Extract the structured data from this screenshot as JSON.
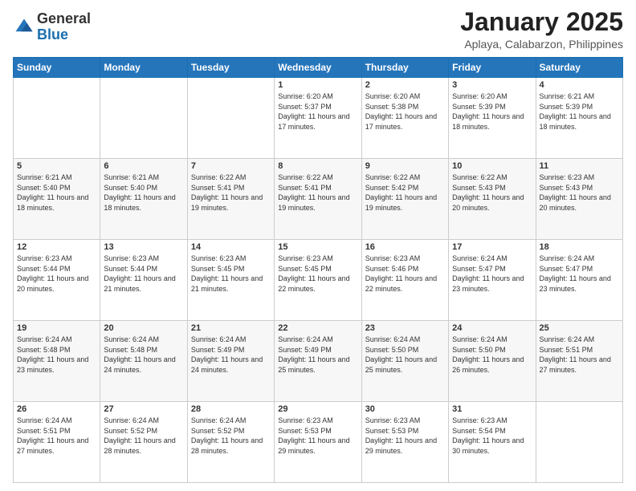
{
  "header": {
    "logo_general": "General",
    "logo_blue": "Blue",
    "month_title": "January 2025",
    "location": "Aplaya, Calabarzon, Philippines"
  },
  "weekdays": [
    "Sunday",
    "Monday",
    "Tuesday",
    "Wednesday",
    "Thursday",
    "Friday",
    "Saturday"
  ],
  "weeks": [
    [
      {
        "day": "",
        "sunrise": "",
        "sunset": "",
        "daylight": ""
      },
      {
        "day": "",
        "sunrise": "",
        "sunset": "",
        "daylight": ""
      },
      {
        "day": "",
        "sunrise": "",
        "sunset": "",
        "daylight": ""
      },
      {
        "day": "1",
        "sunrise": "6:20 AM",
        "sunset": "5:37 PM",
        "daylight": "11 hours and 17 minutes."
      },
      {
        "day": "2",
        "sunrise": "6:20 AM",
        "sunset": "5:38 PM",
        "daylight": "11 hours and 17 minutes."
      },
      {
        "day": "3",
        "sunrise": "6:20 AM",
        "sunset": "5:39 PM",
        "daylight": "11 hours and 18 minutes."
      },
      {
        "day": "4",
        "sunrise": "6:21 AM",
        "sunset": "5:39 PM",
        "daylight": "11 hours and 18 minutes."
      }
    ],
    [
      {
        "day": "5",
        "sunrise": "6:21 AM",
        "sunset": "5:40 PM",
        "daylight": "11 hours and 18 minutes."
      },
      {
        "day": "6",
        "sunrise": "6:21 AM",
        "sunset": "5:40 PM",
        "daylight": "11 hours and 18 minutes."
      },
      {
        "day": "7",
        "sunrise": "6:22 AM",
        "sunset": "5:41 PM",
        "daylight": "11 hours and 19 minutes."
      },
      {
        "day": "8",
        "sunrise": "6:22 AM",
        "sunset": "5:41 PM",
        "daylight": "11 hours and 19 minutes."
      },
      {
        "day": "9",
        "sunrise": "6:22 AM",
        "sunset": "5:42 PM",
        "daylight": "11 hours and 19 minutes."
      },
      {
        "day": "10",
        "sunrise": "6:22 AM",
        "sunset": "5:43 PM",
        "daylight": "11 hours and 20 minutes."
      },
      {
        "day": "11",
        "sunrise": "6:23 AM",
        "sunset": "5:43 PM",
        "daylight": "11 hours and 20 minutes."
      }
    ],
    [
      {
        "day": "12",
        "sunrise": "6:23 AM",
        "sunset": "5:44 PM",
        "daylight": "11 hours and 20 minutes."
      },
      {
        "day": "13",
        "sunrise": "6:23 AM",
        "sunset": "5:44 PM",
        "daylight": "11 hours and 21 minutes."
      },
      {
        "day": "14",
        "sunrise": "6:23 AM",
        "sunset": "5:45 PM",
        "daylight": "11 hours and 21 minutes."
      },
      {
        "day": "15",
        "sunrise": "6:23 AM",
        "sunset": "5:45 PM",
        "daylight": "11 hours and 22 minutes."
      },
      {
        "day": "16",
        "sunrise": "6:23 AM",
        "sunset": "5:46 PM",
        "daylight": "11 hours and 22 minutes."
      },
      {
        "day": "17",
        "sunrise": "6:24 AM",
        "sunset": "5:47 PM",
        "daylight": "11 hours and 23 minutes."
      },
      {
        "day": "18",
        "sunrise": "6:24 AM",
        "sunset": "5:47 PM",
        "daylight": "11 hours and 23 minutes."
      }
    ],
    [
      {
        "day": "19",
        "sunrise": "6:24 AM",
        "sunset": "5:48 PM",
        "daylight": "11 hours and 23 minutes."
      },
      {
        "day": "20",
        "sunrise": "6:24 AM",
        "sunset": "5:48 PM",
        "daylight": "11 hours and 24 minutes."
      },
      {
        "day": "21",
        "sunrise": "6:24 AM",
        "sunset": "5:49 PM",
        "daylight": "11 hours and 24 minutes."
      },
      {
        "day": "22",
        "sunrise": "6:24 AM",
        "sunset": "5:49 PM",
        "daylight": "11 hours and 25 minutes."
      },
      {
        "day": "23",
        "sunrise": "6:24 AM",
        "sunset": "5:50 PM",
        "daylight": "11 hours and 25 minutes."
      },
      {
        "day": "24",
        "sunrise": "6:24 AM",
        "sunset": "5:50 PM",
        "daylight": "11 hours and 26 minutes."
      },
      {
        "day": "25",
        "sunrise": "6:24 AM",
        "sunset": "5:51 PM",
        "daylight": "11 hours and 27 minutes."
      }
    ],
    [
      {
        "day": "26",
        "sunrise": "6:24 AM",
        "sunset": "5:51 PM",
        "daylight": "11 hours and 27 minutes."
      },
      {
        "day": "27",
        "sunrise": "6:24 AM",
        "sunset": "5:52 PM",
        "daylight": "11 hours and 28 minutes."
      },
      {
        "day": "28",
        "sunrise": "6:24 AM",
        "sunset": "5:52 PM",
        "daylight": "11 hours and 28 minutes."
      },
      {
        "day": "29",
        "sunrise": "6:23 AM",
        "sunset": "5:53 PM",
        "daylight": "11 hours and 29 minutes."
      },
      {
        "day": "30",
        "sunrise": "6:23 AM",
        "sunset": "5:53 PM",
        "daylight": "11 hours and 29 minutes."
      },
      {
        "day": "31",
        "sunrise": "6:23 AM",
        "sunset": "5:54 PM",
        "daylight": "11 hours and 30 minutes."
      },
      {
        "day": "",
        "sunrise": "",
        "sunset": "",
        "daylight": ""
      }
    ]
  ],
  "labels": {
    "sunrise_prefix": "Sunrise: ",
    "sunset_prefix": "Sunset: ",
    "daylight_prefix": "Daylight: "
  }
}
